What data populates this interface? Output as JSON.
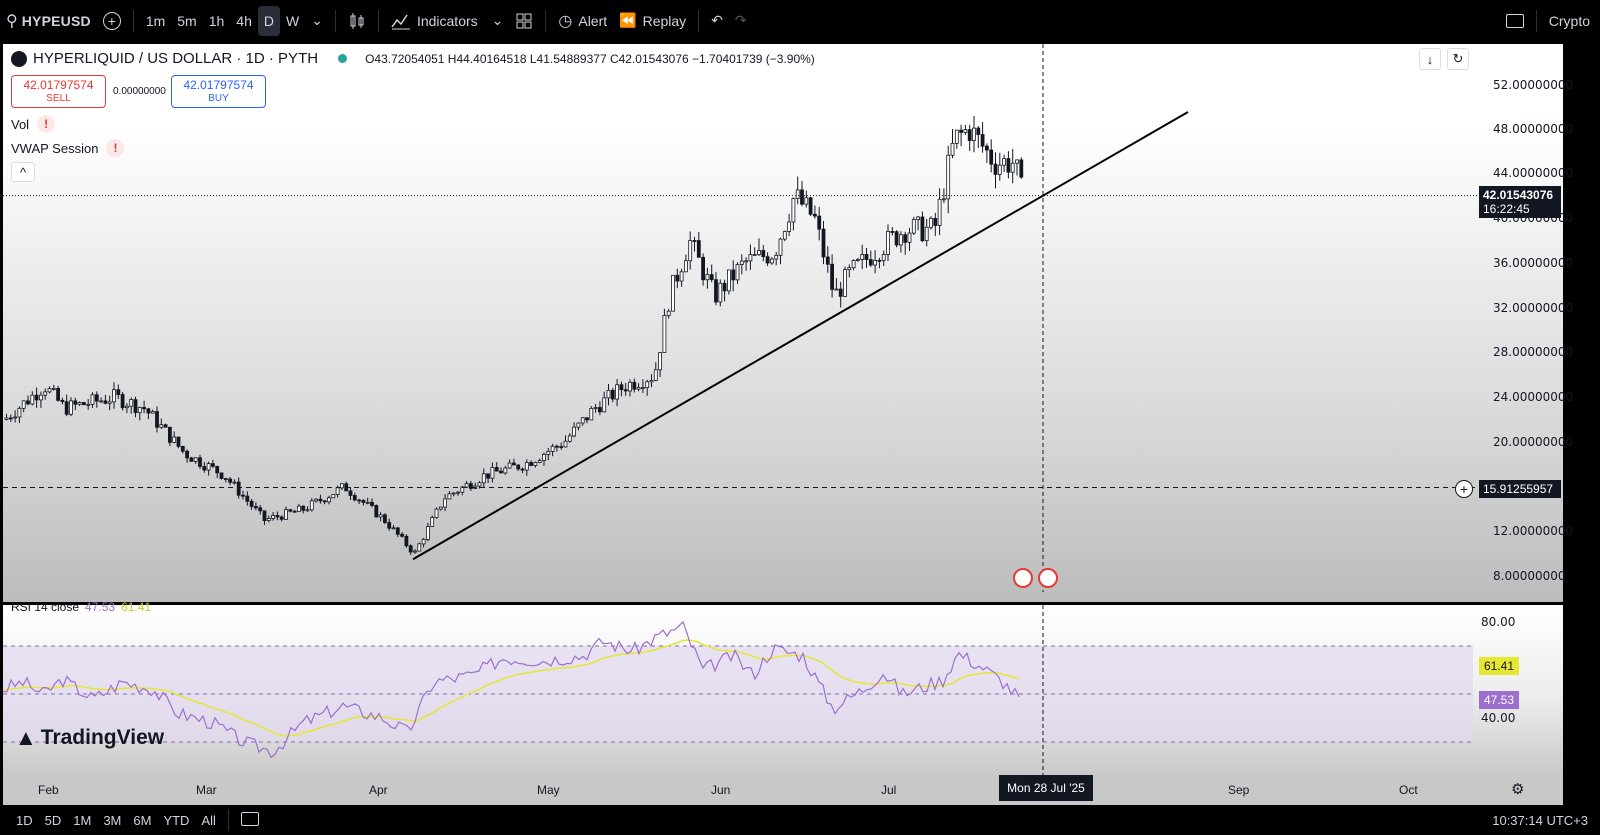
{
  "topbar": {
    "symbol": "HYPEUSD",
    "intervals": [
      "1m",
      "5m",
      "1h",
      "4h",
      "D",
      "W"
    ],
    "active_interval": "D",
    "indicators_label": "Indicators",
    "alert_label": "Alert",
    "replay_label": "Replay",
    "market_label": "Crypto"
  },
  "legend": {
    "title": "HYPERLIQUID / US DOLLAR · 1D · PYTH",
    "ohlc": "O43.72054051  H44.40164518  L41.54889377  C42.01543076  −1.70401739 (−3.90%)"
  },
  "trade": {
    "sell_price": "42.01797574",
    "sell_label": "SELL",
    "spread": "0.00000000",
    "buy_price": "42.01797574",
    "buy_label": "BUY"
  },
  "indicators": {
    "vol_label": "Vol",
    "vwap_label": "VWAP Session",
    "warn": "!",
    "collapse": "^"
  },
  "price_axis": [
    "52.00000000",
    "48.00000000",
    "44.00000000",
    "40.00000000",
    "36.00000000",
    "32.00000000",
    "28.00000000",
    "24.00000000",
    "20.00000000",
    "12.00000000",
    "8.00000000"
  ],
  "current_price": {
    "value": "42.01543076",
    "countdown": "16:22:45"
  },
  "horizontal_line": {
    "value": "15.91255957"
  },
  "rsi": {
    "label": "RSI 14 close",
    "value": "47.53",
    "ma_value": "61.41",
    "axis": [
      "80.00",
      "40.00"
    ]
  },
  "x_axis": {
    "months": [
      "Feb",
      "Mar",
      "Apr",
      "May",
      "Jun",
      "Jul",
      "Sep",
      "Oct"
    ],
    "crosshair_date": "Mon 28 Jul '25"
  },
  "bottombar": {
    "ranges": [
      "1D",
      "5D",
      "1M",
      "3M",
      "6M",
      "YTD",
      "All"
    ],
    "clock": "10:37:14 UTC+3"
  },
  "brand": "TradingView",
  "colors": {
    "up": "#ffffff",
    "down": "#131722",
    "rsi_line": "#9c6fcf",
    "rsi_ma": "#e6e635",
    "sell": "#e53935",
    "buy": "#2962ff"
  },
  "chart_data": {
    "type": "candlestick",
    "title": "HYPERLIQUID / US DOLLAR · 1D · PYTH",
    "y_range": [
      8,
      52
    ],
    "approx_closes": [
      {
        "date": "Feb",
        "close": 22
      },
      {
        "date": "Mar",
        "close": 19
      },
      {
        "date": "Apr",
        "close": 10
      },
      {
        "date": "May",
        "close": 20
      },
      {
        "date": "Jun",
        "close": 37
      },
      {
        "date": "Jul",
        "close": 38
      },
      {
        "date": "Jul 28",
        "close": 42.02
      }
    ],
    "trendline": {
      "from": [
        "Apr 7",
        9.5
      ],
      "to": [
        "Aug 20",
        49.5
      ]
    },
    "horizontal_line": 15.91255957
  }
}
